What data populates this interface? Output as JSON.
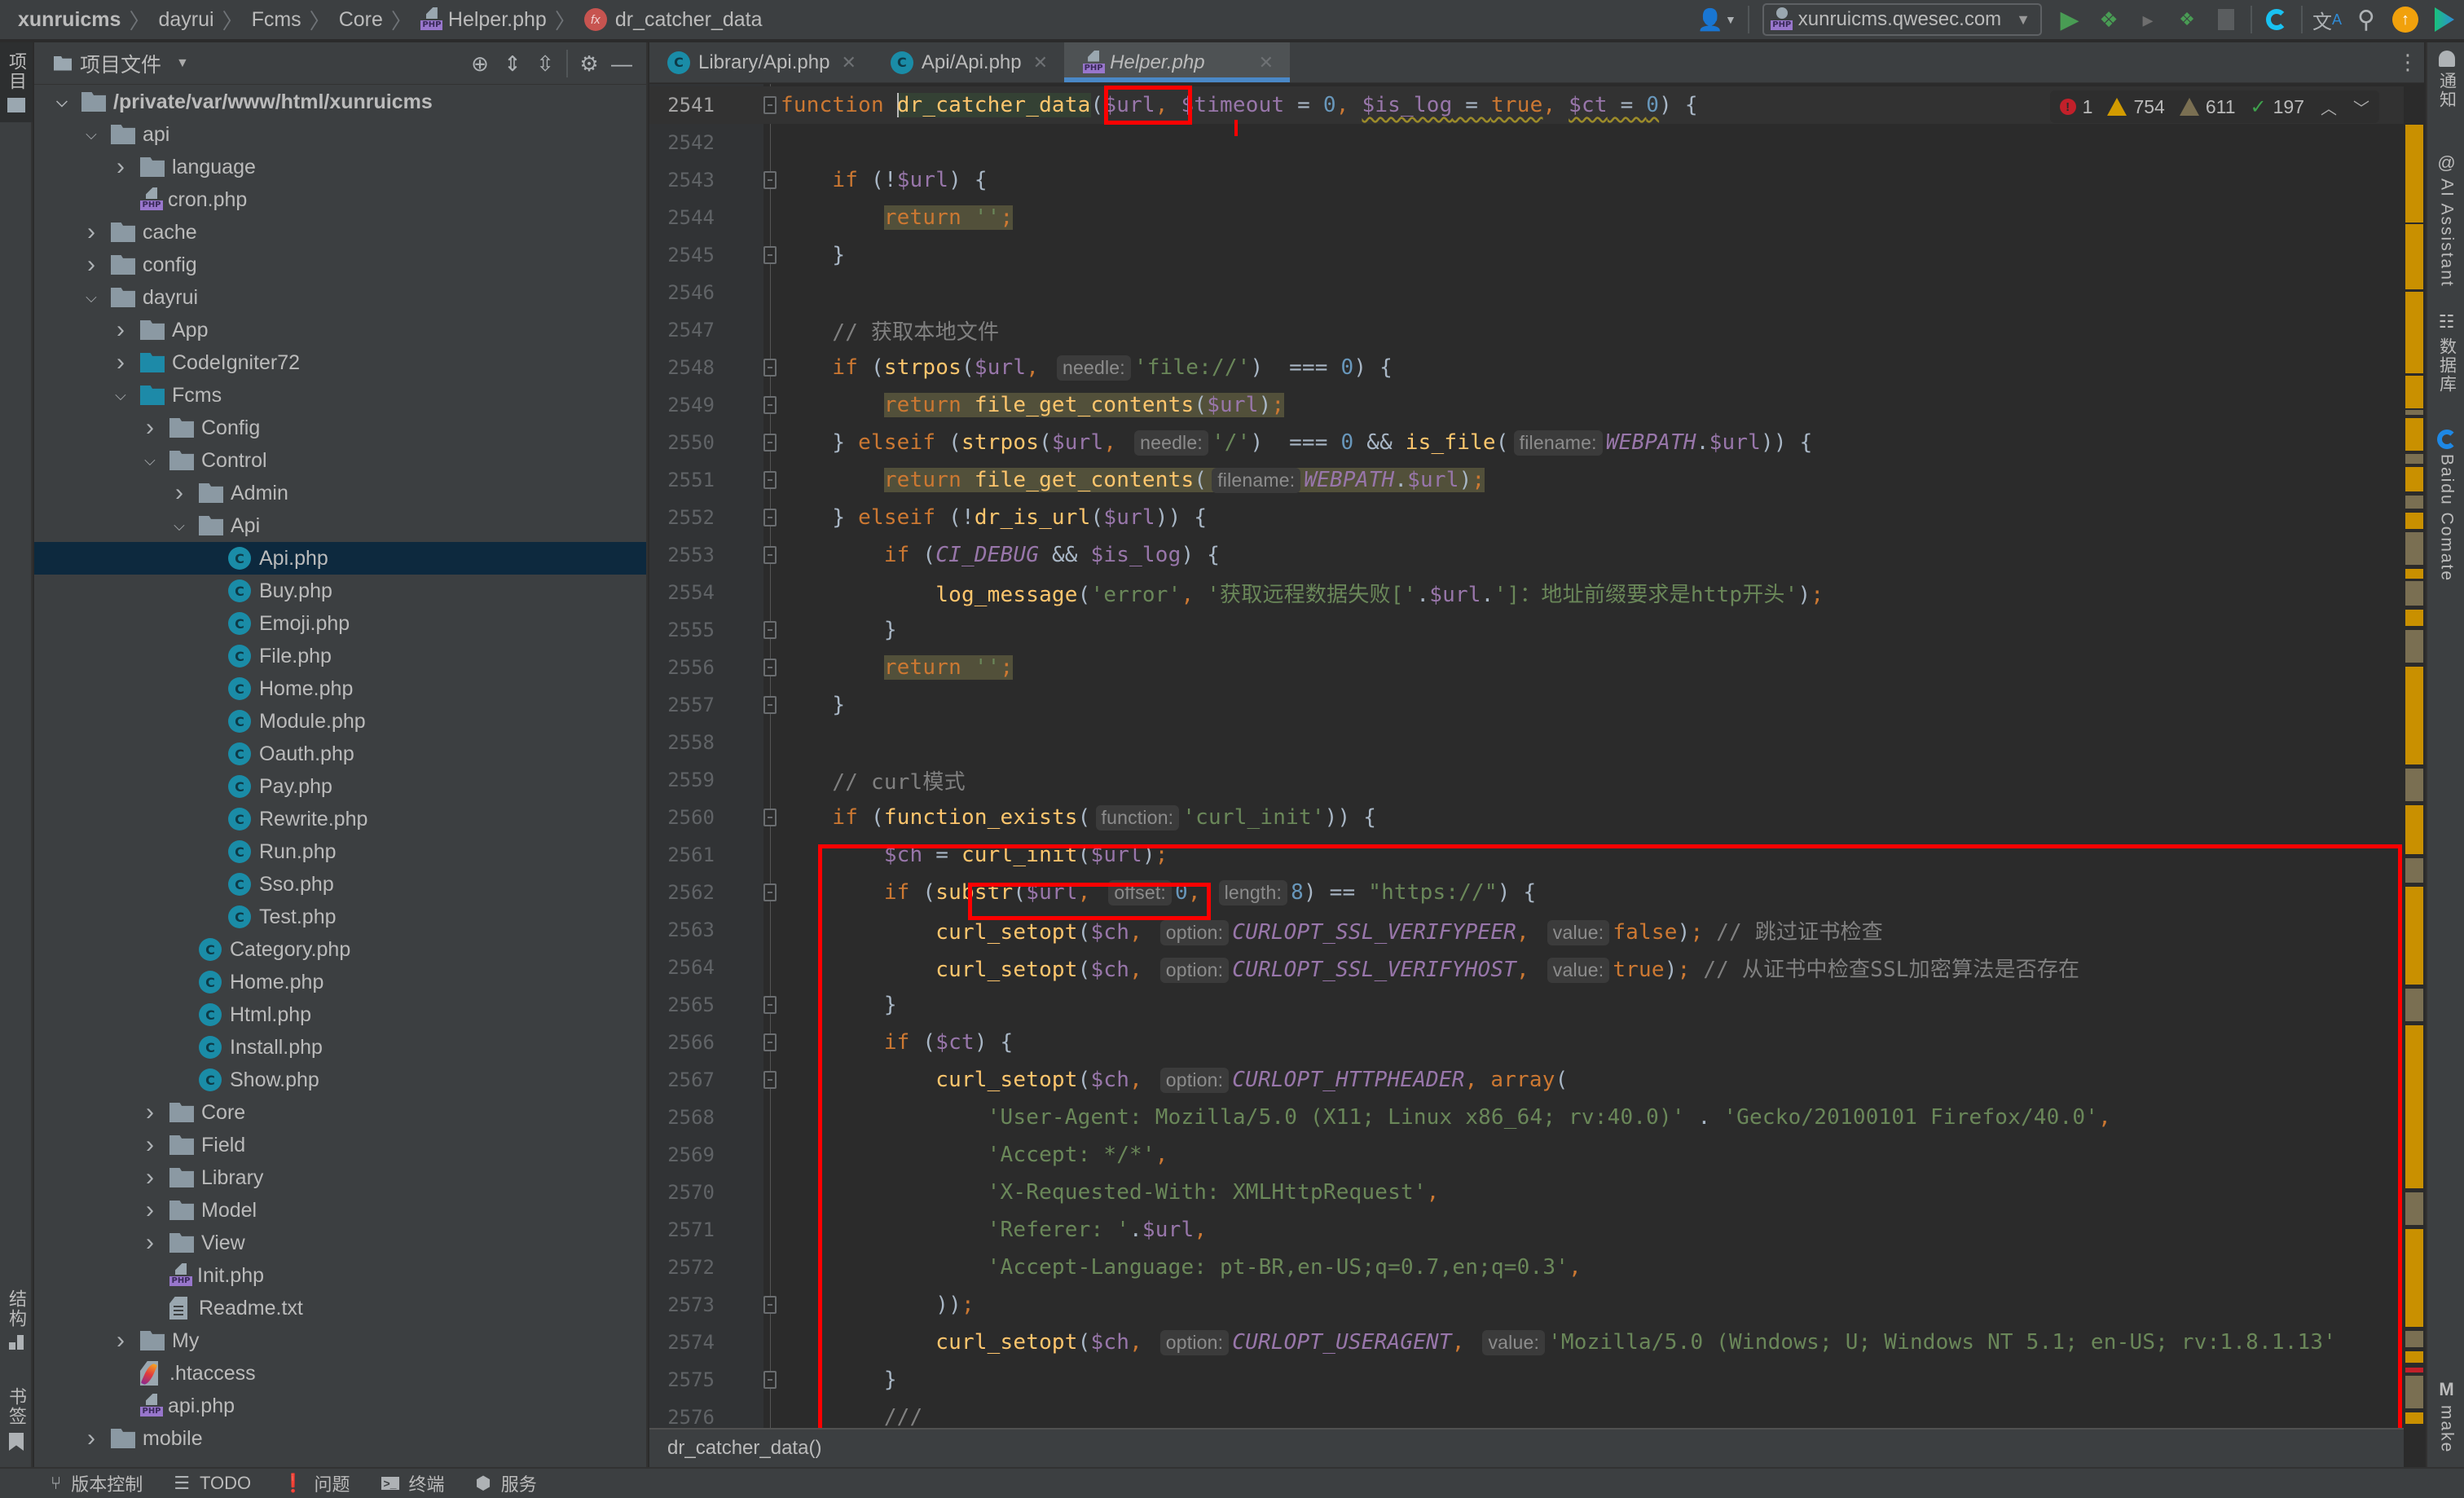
{
  "navbar": {
    "breadcrumbs": [
      "xunruicms",
      "dayrui",
      "Fcms",
      "Core",
      "Helper.php",
      "dr_catcher_data"
    ],
    "run_config": "xunruicms.qwesec.com",
    "icons": [
      "user-icon",
      "run-icon",
      "debug-icon",
      "coverage-icon",
      "remote-debug-icon",
      "stop-icon",
      "comate-icon",
      "translate-icon",
      "search-icon",
      "update-icon",
      "plugin-icon"
    ]
  },
  "left_strip": {
    "project_tab": "项目",
    "structure_tab": "结构",
    "bookmarks_tab": "书签"
  },
  "project_panel": {
    "title": "项目文件",
    "tree": [
      {
        "label": "/private/var/www/html/xunruicms",
        "depth": 0,
        "type": "folder",
        "expanded": true,
        "bold": true
      },
      {
        "label": "api",
        "depth": 1,
        "type": "folder",
        "expanded": true
      },
      {
        "label": "language",
        "depth": 2,
        "type": "folder",
        "expanded": false
      },
      {
        "label": "cron.php",
        "depth": 2,
        "type": "php"
      },
      {
        "label": "cache",
        "depth": 1,
        "type": "folder",
        "expanded": false
      },
      {
        "label": "config",
        "depth": 1,
        "type": "folder",
        "expanded": false
      },
      {
        "label": "dayrui",
        "depth": 1,
        "type": "folder",
        "expanded": true
      },
      {
        "label": "App",
        "depth": 2,
        "type": "folder",
        "expanded": false
      },
      {
        "label": "CodeIgniter72",
        "depth": 2,
        "type": "folder-teal",
        "expanded": false
      },
      {
        "label": "Fcms",
        "depth": 2,
        "type": "folder-teal",
        "expanded": true
      },
      {
        "label": "Config",
        "depth": 3,
        "type": "folder",
        "expanded": false
      },
      {
        "label": "Control",
        "depth": 3,
        "type": "folder",
        "expanded": true
      },
      {
        "label": "Admin",
        "depth": 4,
        "type": "folder",
        "expanded": false
      },
      {
        "label": "Api",
        "depth": 4,
        "type": "folder",
        "expanded": true
      },
      {
        "label": "Api.php",
        "depth": 5,
        "type": "class",
        "selected": true
      },
      {
        "label": "Buy.php",
        "depth": 5,
        "type": "class"
      },
      {
        "label": "Emoji.php",
        "depth": 5,
        "type": "class"
      },
      {
        "label": "File.php",
        "depth": 5,
        "type": "class"
      },
      {
        "label": "Home.php",
        "depth": 5,
        "type": "class"
      },
      {
        "label": "Module.php",
        "depth": 5,
        "type": "class"
      },
      {
        "label": "Oauth.php",
        "depth": 5,
        "type": "class"
      },
      {
        "label": "Pay.php",
        "depth": 5,
        "type": "class"
      },
      {
        "label": "Rewrite.php",
        "depth": 5,
        "type": "class"
      },
      {
        "label": "Run.php",
        "depth": 5,
        "type": "class"
      },
      {
        "label": "Sso.php",
        "depth": 5,
        "type": "class"
      },
      {
        "label": "Test.php",
        "depth": 5,
        "type": "class"
      },
      {
        "label": "Category.php",
        "depth": 4,
        "type": "class"
      },
      {
        "label": "Home.php",
        "depth": 4,
        "type": "class"
      },
      {
        "label": "Html.php",
        "depth": 4,
        "type": "class"
      },
      {
        "label": "Install.php",
        "depth": 4,
        "type": "class"
      },
      {
        "label": "Show.php",
        "depth": 4,
        "type": "class"
      },
      {
        "label": "Core",
        "depth": 3,
        "type": "folder",
        "expanded": false
      },
      {
        "label": "Field",
        "depth": 3,
        "type": "folder",
        "expanded": false
      },
      {
        "label": "Library",
        "depth": 3,
        "type": "folder",
        "expanded": false
      },
      {
        "label": "Model",
        "depth": 3,
        "type": "folder",
        "expanded": false
      },
      {
        "label": "View",
        "depth": 3,
        "type": "folder",
        "expanded": false
      },
      {
        "label": "Init.php",
        "depth": 3,
        "type": "php"
      },
      {
        "label": "Readme.txt",
        "depth": 3,
        "type": "text"
      },
      {
        "label": "My",
        "depth": 2,
        "type": "folder",
        "expanded": false
      },
      {
        "label": ".htaccess",
        "depth": 2,
        "type": "htaccess"
      },
      {
        "label": "api.php",
        "depth": 2,
        "type": "php"
      },
      {
        "label": "mobile",
        "depth": 1,
        "type": "folder",
        "expanded": false
      }
    ]
  },
  "editor": {
    "tabs": [
      {
        "label": "Library/Api.php",
        "icon": "class",
        "active": false
      },
      {
        "label": "Api/Api.php",
        "icon": "class",
        "active": false
      },
      {
        "label": "Helper.php",
        "icon": "php",
        "active": true
      }
    ],
    "inspections": {
      "errors": "1",
      "warnings": "754",
      "weak_warnings": "611",
      "typos": "197"
    },
    "lines": [
      {
        "n": "2541",
        "html": "<span class=\"kw\">function </span><span class=\"hl-fname\"><span class=\"caret\"></span><span class=\"fn\">dr_catcher_data</span></span>(<span class=\"var\">$url</span><span class=\"kw\">,</span> <span class=\"var\">$timeout</span> = <span class=\"num\">0</span><span class=\"kw\">,</span> <span class=\"uline\"><span class=\"var\">$is_log</span> = <span class=\"kw\">true</span></span><span class=\"kw\">,</span> <span class=\"uline\"><span class=\"var\">$ct</span> = <span class=\"num\">0</span></span>) {"
      },
      {
        "n": "2542",
        "html": ""
      },
      {
        "n": "2543",
        "html": "    <span class=\"kw\">if</span> (!<span class=\"var\">$url</span>) {"
      },
      {
        "n": "2544",
        "html": "        <span class=\"hl-ret\"><span class=\"kw\">return</span> <span class=\"str\">''</span><span class=\"kw\">;</span></span>"
      },
      {
        "n": "2545",
        "html": "    }"
      },
      {
        "n": "2546",
        "html": ""
      },
      {
        "n": "2547",
        "html": "    <span class=\"cm\">// 获取本地文件</span>"
      },
      {
        "n": "2548",
        "html": "    <span class=\"kw\">if</span> (<span class=\"fn\">strpos</span>(<span class=\"var\">$url</span><span class=\"kw\">,</span> <span class=\"hint\">needle:</span><span class=\"str\">'file://'</span>)  === <span class=\"num\">0</span>) {"
      },
      {
        "n": "2549",
        "html": "        <span class=\"hl-ret\"><span class=\"kw\">return</span> <span class=\"fn\">file_get_contents</span>(<span class=\"var\">$url</span>)<span class=\"kw\">;</span></span>"
      },
      {
        "n": "2550",
        "html": "    } <span class=\"kw\">elseif</span> (<span class=\"fn\">strpos</span>(<span class=\"var\">$url</span><span class=\"kw\">,</span> <span class=\"hint\">needle:</span><span class=\"str\">'/'</span>)  === <span class=\"num\">0</span> &amp;&amp; <span class=\"fn\">is_file</span>(<span class=\"hint\">filename:</span><span class=\"const\">WEBPATH</span>.<span class=\"var\">$url</span>)) {"
      },
      {
        "n": "2551",
        "html": "        <span class=\"hl-ret\"><span class=\"kw\">return</span> <span class=\"fn\">file_get_contents</span>(<span class=\"hint\">filename:</span><span class=\"const\">WEBPATH</span>.<span class=\"var\">$url</span>)<span class=\"kw\">;</span></span>"
      },
      {
        "n": "2552",
        "html": "    } <span class=\"kw\">elseif</span> (!<span class=\"fn\">dr_is_url</span>(<span class=\"var\">$url</span>)) {"
      },
      {
        "n": "2553",
        "html": "        <span class=\"kw\">if</span> (<span class=\"const\">CI_DEBUG</span> &amp;&amp; <span class=\"var\">$is_log</span>) {"
      },
      {
        "n": "2554",
        "html": "            <span class=\"fn\">log_message</span>(<span class=\"str\">'error'</span><span class=\"kw\">,</span> <span class=\"str\">'获取远程数据失败['</span>.<span class=\"var\">$url</span>.<span class=\"str\">']：地址前缀要求是http开头'</span>)<span class=\"kw\">;</span>"
      },
      {
        "n": "2555",
        "html": "        }"
      },
      {
        "n": "2556",
        "html": "        <span class=\"hl-ret\"><span class=\"kw\">return</span> <span class=\"str\">''</span><span class=\"kw\">;</span></span>"
      },
      {
        "n": "2557",
        "html": "    }"
      },
      {
        "n": "2558",
        "html": ""
      },
      {
        "n": "2559",
        "html": "    <span class=\"cm\">// curl模式</span>"
      },
      {
        "n": "2560",
        "html": "    <span class=\"kw\">if</span> (<span class=\"fn\">function_exists</span>(<span class=\"hint\">function:</span><span class=\"str\">'curl_init'</span>)) {"
      },
      {
        "n": "2561",
        "html": "        <span class=\"var\">$ch</span> = <span class=\"fn\">curl_init</span>(<span class=\"var\">$url</span>)<span class=\"kw\">;</span>"
      },
      {
        "n": "2562",
        "html": "        <span class=\"kw\">if</span> (<span class=\"fn\">substr</span>(<span class=\"var\">$url</span><span class=\"kw\">,</span> <span class=\"hint\">offset:</span><span class=\"num\">0</span><span class=\"kw\">,</span> <span class=\"hint\">length:</span><span class=\"num\">8</span>) == <span class=\"str\">\"https://\"</span>) {"
      },
      {
        "n": "2563",
        "html": "            <span class=\"fn\">curl_setopt</span>(<span class=\"var\">$ch</span><span class=\"kw\">,</span> <span class=\"hint\">option:</span><span class=\"const\">CURLOPT_SSL_VERIFYPEER</span><span class=\"kw\">,</span> <span class=\"hint\">value:</span><span class=\"kw\">false</span>)<span class=\"kw\">;</span> <span class=\"cm\">// 跳过证书检查</span>"
      },
      {
        "n": "2564",
        "html": "            <span class=\"fn\">curl_setopt</span>(<span class=\"var\">$ch</span><span class=\"kw\">,</span> <span class=\"hint\">option:</span><span class=\"const\">CURLOPT_SSL_VERIFYHOST</span><span class=\"kw\">,</span> <span class=\"hint\">value:</span><span class=\"kw\">true</span>)<span class=\"kw\">;</span> <span class=\"cm\">// 从证书中检查SSL加密算法是否存在</span>"
      },
      {
        "n": "2565",
        "html": "        }"
      },
      {
        "n": "2566",
        "html": "        <span class=\"kw\">if</span> (<span class=\"var\">$ct</span>) {"
      },
      {
        "n": "2567",
        "html": "            <span class=\"fn\">curl_setopt</span>(<span class=\"var\">$ch</span><span class=\"kw\">,</span> <span class=\"hint\">option:</span><span class=\"const\">CURLOPT_HTTPHEADER</span><span class=\"kw\">,</span> <span class=\"kw\">array</span>("
      },
      {
        "n": "2568",
        "html": "                <span class=\"str\">'User-Agent: Mozilla/5.0 (X11; Linux x86_64; rv:40.0)'</span> . <span class=\"str\">'Gecko/20100101 Firefox/40.0'</span><span class=\"kw\">,</span>"
      },
      {
        "n": "2569",
        "html": "                <span class=\"str\">'Accept: */*'</span><span class=\"kw\">,</span>"
      },
      {
        "n": "2570",
        "html": "                <span class=\"str\">'X-Requested-With: XMLHttpRequest'</span><span class=\"kw\">,</span>"
      },
      {
        "n": "2571",
        "html": "                <span class=\"str\">'Referer: '</span>.<span class=\"var\">$url</span><span class=\"kw\">,</span>"
      },
      {
        "n": "2572",
        "html": "                <span class=\"str\">'Accept-Language: pt-BR,en-US;q=0.7,en;q=0.3'</span><span class=\"kw\">,</span>"
      },
      {
        "n": "2573",
        "html": "            ))<span class=\"kw\">;</span>"
      },
      {
        "n": "2574",
        "html": "            <span class=\"fn\">curl_setopt</span>(<span class=\"var\">$ch</span><span class=\"kw\">,</span> <span class=\"hint\">option:</span><span class=\"const\">CURLOPT_USERAGENT</span><span class=\"kw\">,</span> <span class=\"hint\">value:</span><span class=\"str\">'Mozilla/5.0 (Windows; U; Windows NT 5.1; en-US; rv:1.8.1.13'</span>"
      },
      {
        "n": "2575",
        "html": "        }"
      },
      {
        "n": "2576",
        "html": "        <span class=\"cm\">///</span>"
      }
    ],
    "function_breadcrumb": "dr_catcher_data()"
  },
  "right_strip": {
    "notifications": "通知",
    "ai_assistant": "AI Assistant",
    "database": "数据库",
    "baidu_comate": "Baidu Comate",
    "make": "make"
  },
  "bottom_bar": {
    "items": [
      "版本控制",
      "TODO",
      "问题",
      "终端",
      "服务"
    ]
  },
  "colors": {
    "annotation_red": "#ff0000",
    "selection": "#0d293e",
    "accent_tab": "#4a88c7"
  }
}
